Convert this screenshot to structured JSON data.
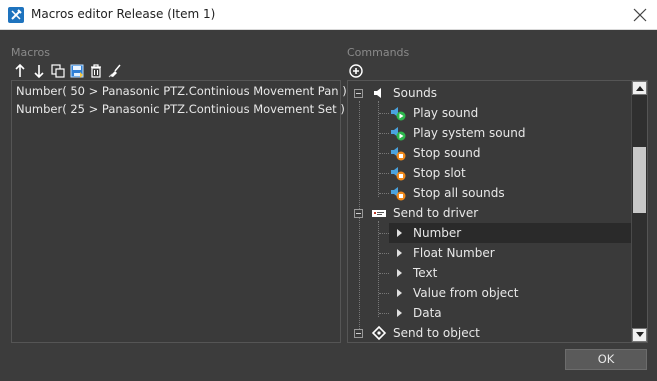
{
  "window": {
    "title": "Macros editor Release (Item 1)",
    "close_icon": "close-icon"
  },
  "macros": {
    "label": "Macros",
    "toolbar": [
      {
        "name": "move-up-icon"
      },
      {
        "name": "move-down-icon"
      },
      {
        "name": "copy-icon"
      },
      {
        "name": "save-icon"
      },
      {
        "name": "delete-icon"
      },
      {
        "name": "clear-icon"
      }
    ],
    "lines": [
      "Number( 50 > Panasonic PTZ.Continious Movement Pan )",
      "Number( 25 > Panasonic PTZ.Continious Movement Set )"
    ]
  },
  "commands": {
    "label": "Commands",
    "add_icon": "add-circle-icon",
    "tree": {
      "sounds": {
        "label": "Sounds",
        "icon": "speaker-icon"
      },
      "sound_items": [
        {
          "label": "Play sound",
          "icon": "play-sound-icon"
        },
        {
          "label": "Play system sound",
          "icon": "play-system-sound-icon"
        },
        {
          "label": "Stop sound",
          "icon": "stop-sound-icon"
        },
        {
          "label": "Stop slot",
          "icon": "stop-slot-icon"
        },
        {
          "label": "Stop all sounds",
          "icon": "stop-all-sounds-icon"
        }
      ],
      "send_to_driver": {
        "label": "Send to driver",
        "icon": "driver-icon"
      },
      "driver_items": [
        {
          "label": "Number",
          "selected": true
        },
        {
          "label": "Float Number"
        },
        {
          "label": "Text"
        },
        {
          "label": "Value from object"
        },
        {
          "label": "Data"
        }
      ],
      "send_to_object": {
        "label": "Send to object",
        "icon": "object-icon"
      }
    }
  },
  "footer": {
    "ok_label": "OK"
  },
  "colors": {
    "background": "#3c3c3c",
    "panel": "#3a3a3a",
    "selected_row": "#2a2a2a",
    "speaker_green": "#2db84d",
    "stop_orange": "#f08a1c"
  }
}
